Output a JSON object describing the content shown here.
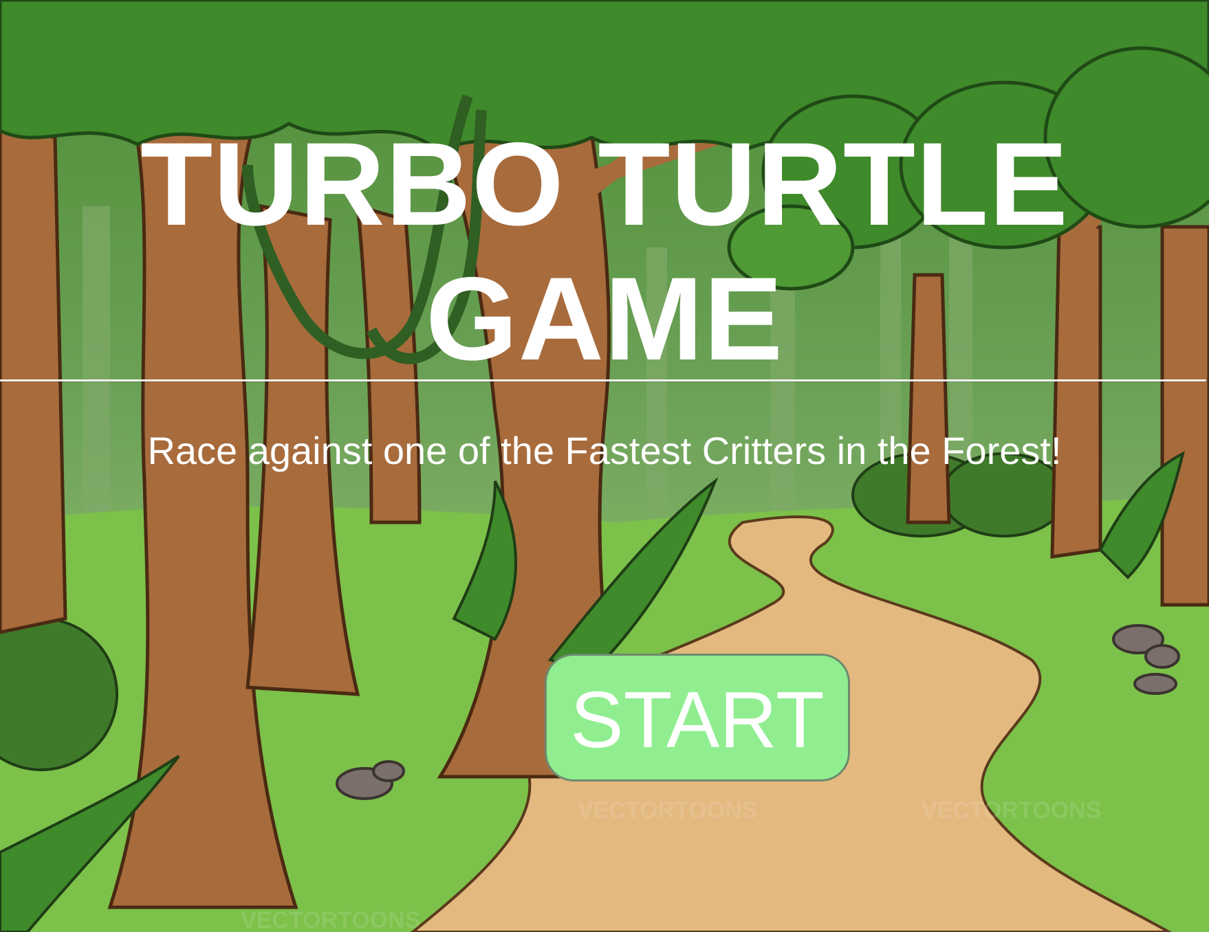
{
  "game": {
    "title_line1": "TURBO TURTLE",
    "title_line2": "GAME",
    "subtitle": "Race against one of the Fastest Critters in the Forest!",
    "start_label": "START"
  },
  "background": {
    "scene": "cartoon forest with brown trees, green canopy and a dirt path",
    "watermark": "VECTORTOONS"
  },
  "colors": {
    "title_text": "#ffffff",
    "start_button_bg": "#90ee90",
    "start_button_border": "#6e8a6e",
    "canopy": "#3f8a2b",
    "trunk": "#a86b3c",
    "path": "#e3b980",
    "grass": "#7cc14a"
  }
}
